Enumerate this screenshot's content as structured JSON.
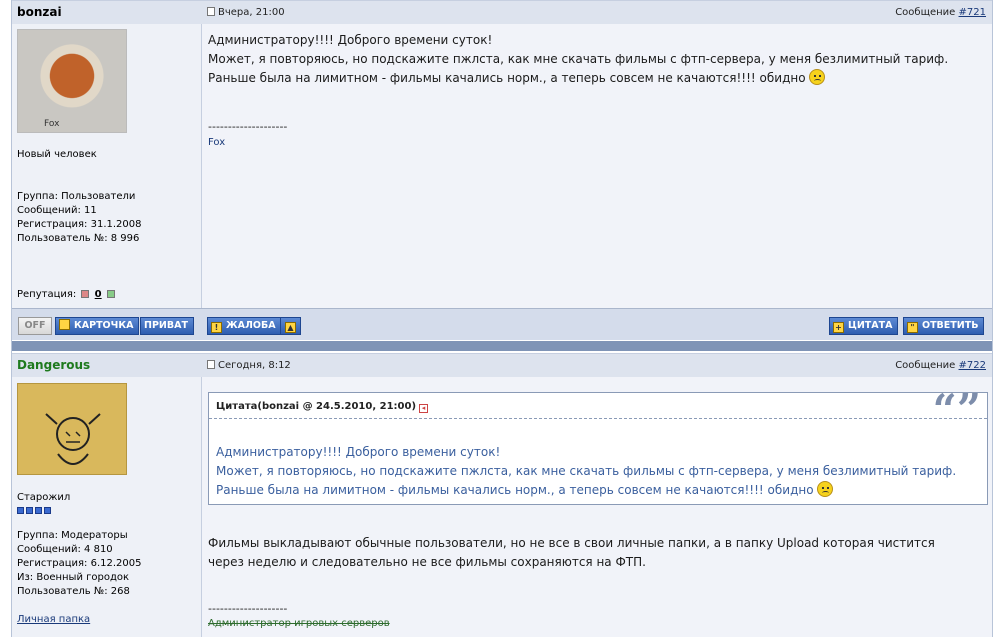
{
  "post1": {
    "author": "bonzai",
    "date": "Вчера, 21:00",
    "msg_prefix": "Сообщение",
    "msg_num": "#721",
    "avatar_label": "Fox",
    "rank": "Новый человек",
    "group": "Группа: Пользователи",
    "messages": "Сообщений: 11",
    "registered": "Регистрация: 31.1.2008",
    "user_no": "Пользователь №: 8 996",
    "rep_label": "Репутация:",
    "rep_value": "0",
    "body": [
      "Администратору!!!! Доброго времени суток!",
      "Может, я повторяюсь, но подскажите пжлста, как мне скачать фильмы с фтп-сервера, у меня безлимитный тариф.",
      "Раньше была на лимитном - фильмы качались норм., а теперь совсем не качаются!!!! обидно"
    ],
    "sig_dashes": "--------------------",
    "sig_link": "Fox"
  },
  "buttons": {
    "off": "OFF",
    "card": "КАРТОЧКА",
    "private": "ПРИВАТ",
    "report": "ЖАЛОБА",
    "quote": "ЦИТАТА",
    "reply": "ОТВЕТИТЬ"
  },
  "post2": {
    "author": "Dangerous",
    "date": "Сегодня, 8:12",
    "msg_prefix": "Сообщение",
    "msg_num": "#722",
    "rank": "Старожил",
    "group": "Группа: Модераторы",
    "messages": "Сообщений: 4 810",
    "registered": "Регистрация: 6.12.2005",
    "from": "Из: Военный городок",
    "user_no": "Пользователь №: 268",
    "personal_folder": "Личная папка",
    "quote_title": "Цитата(bonzai @ 24.5.2010, 21:00)",
    "quote_lines": [
      "Администратору!!!! Доброго времени суток!",
      "Может, я повторяюсь, но подскажите пжлста, как мне скачать фильмы с фтп-сервера, у меня безлимитный тариф.",
      "Раньше была на лимитном - фильмы качались норм., а теперь совсем не качаются!!!! обидно"
    ],
    "body": [
      "Фильмы выкладывают обычные пользователи, но не все в свои личные папки, а в папку Upload которая чистится",
      "через неделю и следовательно не все фильмы сохраняются на ФТП."
    ],
    "sig_dashes": "--------------------",
    "sig_strike": "Администратор игровых серверов"
  },
  "colors": {
    "author1": "#000000",
    "author2": "#1e7a1e",
    "header_bg": "#dde3ee",
    "button_blue": "#2d5db0"
  }
}
